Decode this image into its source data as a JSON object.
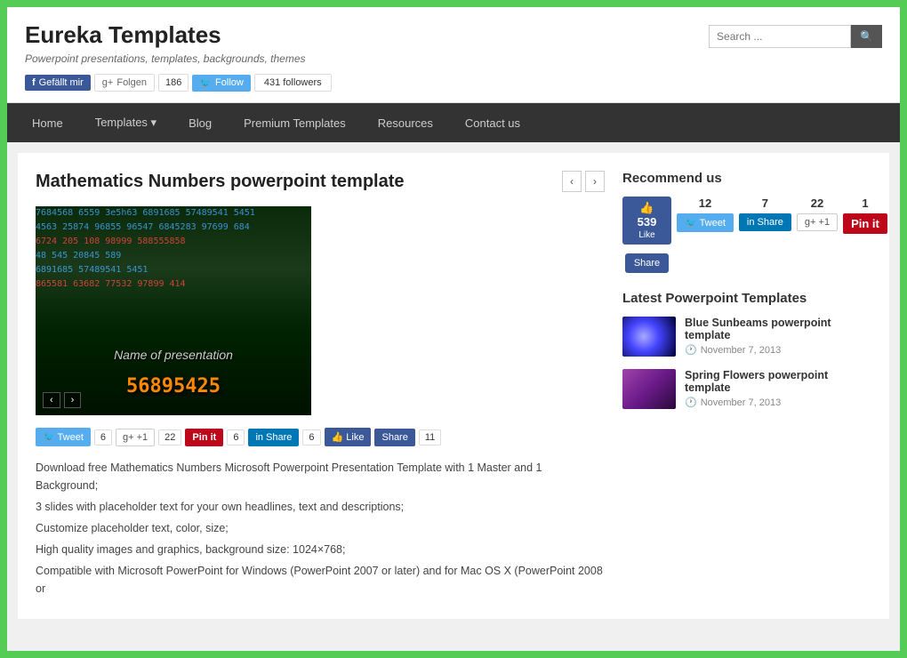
{
  "site": {
    "title": "Eureka Templates",
    "tagline": "Powerpoint presentations, templates, backgrounds, themes",
    "search_placeholder": "Search ..."
  },
  "social": {
    "fb_label": "Gefällt mir",
    "gplus_label": "Folgen",
    "gplus_count": "186",
    "twitter_label": "Follow",
    "twitter_count": "431 followers"
  },
  "nav": {
    "items": [
      {
        "label": "Home"
      },
      {
        "label": "Templates ▾"
      },
      {
        "label": "Blog"
      },
      {
        "label": "Premium Templates"
      },
      {
        "label": "Resources"
      },
      {
        "label": "Contact us"
      }
    ]
  },
  "article": {
    "title": "Mathematics Numbers powerpoint template",
    "description_1": "Download free Mathematics Numbers Microsoft Powerpoint Presentation Template with 1 Master and 1 Background;",
    "description_2": "3 slides with placeholder text for your own headlines, text and descriptions;",
    "description_3": "Customize placeholder text, color, size;",
    "description_4": "High quality images and graphics, background size: 1024×768;",
    "description_5": "Compatible with Microsoft PowerPoint for Windows (PowerPoint 2007 or later) and for Mac OS X (PowerPoint 2008 or",
    "slide_label": "Name of presentation",
    "share": {
      "tweet_count": "6",
      "gplus_count": "22",
      "pin_count": "6",
      "li_count": "6",
      "like_label": "Like",
      "share_label": "Share",
      "like_count": "11"
    }
  },
  "sidebar": {
    "recommend_title": "Recommend us",
    "like_count": "539",
    "like_label": "Like",
    "share_label": "Share",
    "tweet_count": "12",
    "tweet_label": "Tweet",
    "li_count": "7",
    "li_label": "Share",
    "gplus_count": "22",
    "gplus_label": "+1",
    "pin_count": "1",
    "pin_label": "Pin it",
    "latest_title": "Latest Powerpoint Templates",
    "latest_items": [
      {
        "title": "Blue Sunbeams powerpoint template",
        "date": "November 7, 2013",
        "thumb_type": "blue"
      },
      {
        "title": "Spring Flowers powerpoint template",
        "date": "November 7, 2013",
        "thumb_type": "purple"
      }
    ]
  }
}
